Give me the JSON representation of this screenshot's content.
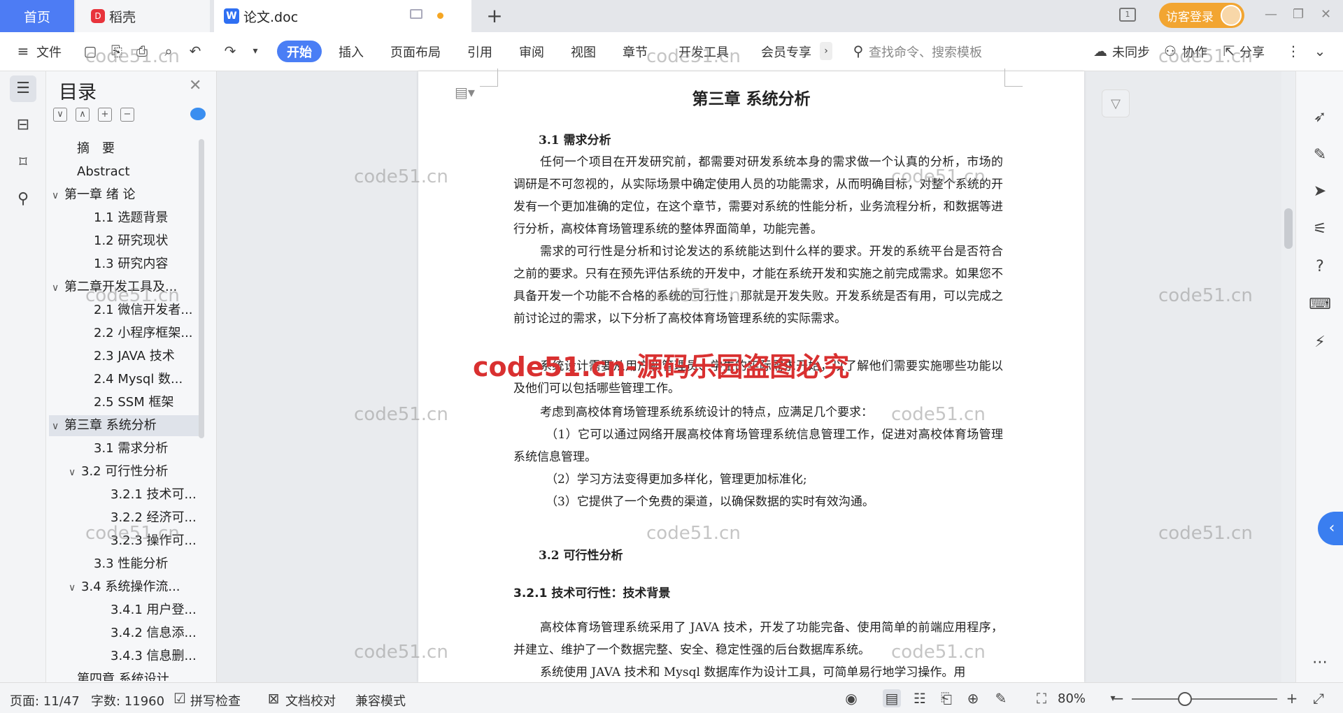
{
  "tabs": {
    "home": "首页",
    "daoke": "稻壳",
    "doc": "论文.doc",
    "login": "访客登录"
  },
  "ribbon": {
    "file": "文件",
    "tabs": [
      "开始",
      "插入",
      "页面布局",
      "引用",
      "审阅",
      "视图",
      "章节",
      "开发工具",
      "会员专享"
    ],
    "search_placeholder": "查找命令、搜索模板",
    "sync": "未同步",
    "collab": "协作",
    "share": "分享"
  },
  "toc": {
    "title": "目录",
    "items": [
      {
        "label": "摘　要",
        "level": 0,
        "arrow": ""
      },
      {
        "label": "Abstract",
        "level": 0,
        "arrow": ""
      },
      {
        "label": "第一章  绪  论",
        "level": 0,
        "arrow": "∨"
      },
      {
        "label": "1.1 选题背景",
        "level": 1,
        "arrow": ""
      },
      {
        "label": "1.2 研究现状",
        "level": 1,
        "arrow": ""
      },
      {
        "label": "1.3 研究内容",
        "level": 1,
        "arrow": ""
      },
      {
        "label": "第二章开发工具及...",
        "level": 0,
        "arrow": "∨"
      },
      {
        "label": "2.1 微信开发者...",
        "level": 1,
        "arrow": ""
      },
      {
        "label": "2.2 小程序框架...",
        "level": 1,
        "arrow": ""
      },
      {
        "label": "2.3 JAVA 技术",
        "level": 1,
        "arrow": ""
      },
      {
        "label": "2.4    Mysql 数...",
        "level": 1,
        "arrow": ""
      },
      {
        "label": "2.5 SSM 框架",
        "level": 1,
        "arrow": ""
      },
      {
        "label": "第三章  系统分析",
        "level": 0,
        "arrow": "∨",
        "selected": true
      },
      {
        "label": "3.1 需求分析",
        "level": 1,
        "arrow": ""
      },
      {
        "label": "3.2 可行性分析",
        "level": 1,
        "arrow": "∨"
      },
      {
        "label": "3.2.1 技术可...",
        "level": 2,
        "arrow": ""
      },
      {
        "label": "3.2.2 经济可...",
        "level": 2,
        "arrow": ""
      },
      {
        "label": "3.2.3 操作可...",
        "level": 2,
        "arrow": ""
      },
      {
        "label": "3.3 性能分析",
        "level": 1,
        "arrow": ""
      },
      {
        "label": "3.4 系统操作流...",
        "level": 1,
        "arrow": "∨"
      },
      {
        "label": "3.4.1 用户登...",
        "level": 2,
        "arrow": ""
      },
      {
        "label": "3.4.2 信息添...",
        "level": 2,
        "arrow": ""
      },
      {
        "label": "3.4.3 信息删...",
        "level": 2,
        "arrow": ""
      },
      {
        "label": "第四章  系统设计",
        "level": 0,
        "arrow": ""
      }
    ]
  },
  "document": {
    "chapter": "第三章  系统分析",
    "sec31": "3.1 需求分析",
    "p1": "任何一个项目在开发研究前，都需要对研发系统本身的需求做一个认真的分析，市场的调研是不可忽视的，从实际场景中确定使用人员的功能需求，从而明确目标，对整个系统的开发有一个更加准确的定位，在这个章节，需要对系统的性能分析，业务流程分析，和数据等进行分析，高校体育场管理系统的整体界面简单，功能完善。",
    "p2": "需求的可行性是分析和讨论发达的系统能达到什么样的要求。开发的系统平台是否符合之前的要求。只有在预先评估系统的开发中，才能在系统开发和实施之前完成需求。如果您不具备开发一个功能不合格的系统的可行性，那就是开发失败。开发系统是否有用，可以完成之前讨论过的需求，以下分析了高校体育场管理系统的实际需求。",
    "p3": "系统设计需要从用户和管理员、学生的实际需求开始，以了解他们需要实施哪些功能以及他们可以包括哪些管理工作。",
    "p4": "考虑到高校体育场管理系统系统设计的特点，应满足几个要求：",
    "p5": "（1）它可以通过网络开展高校体育场管理系统信息管理工作，促进对高校体育场管理系统信息管理。",
    "p6": "（2）学习方法变得更加多样化，管理更加标准化;",
    "p7": "（3）它提供了一个免费的渠道，以确保数据的实时有效沟通。",
    "sec32": "3.2 可行性分析",
    "sec321": "3.2.1 技术可行性：技术背景",
    "p8": "高校体育场管理系统采用了 JAVA 技术，开发了功能完备、使用简单的前端应用程序，并建立、维护了一个数据完整、安全、稳定性强的后台数据库系统。",
    "p9": "系统使用 JAVA 技术和 Mysql 数据库作为设计工具，可简单易行地学习操作。用"
  },
  "watermarks": {
    "small": "code51.cn",
    "big": "code51.cn-源码乐园盗图必究"
  },
  "status": {
    "page": "页面: 11/47",
    "words": "字数: 11960",
    "spell": "拼写检查",
    "proof": "文档校对",
    "compat": "兼容模式",
    "zoom": "80%"
  }
}
